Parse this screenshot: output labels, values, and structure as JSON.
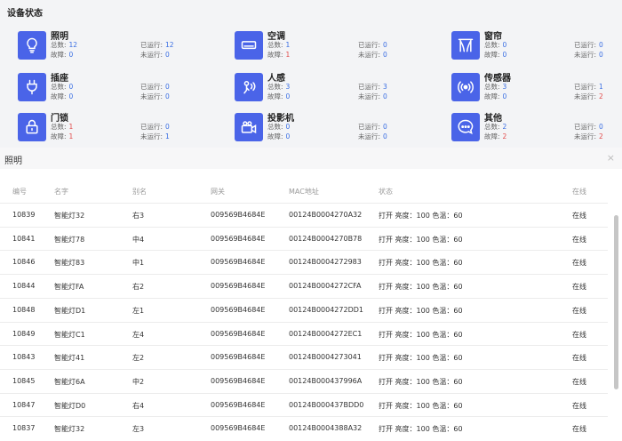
{
  "page_title": "设备状态",
  "labels": {
    "total": "总数:",
    "fault": "故障:",
    "running": "已运行:",
    "stopped": "未运行:"
  },
  "colors": {
    "accent": "#4a64e8",
    "count_blue": "#3b6fe3",
    "count_red": "#e24b4b"
  },
  "cards": [
    {
      "name": "照明",
      "icon": "lightbulb-icon",
      "total": "12",
      "fault": "0",
      "running": "12",
      "stopped": "0"
    },
    {
      "name": "空调",
      "icon": "air-conditioner-icon",
      "total": "1",
      "fault": "1",
      "running": "0",
      "stopped": "0"
    },
    {
      "name": "窗帘",
      "icon": "curtain-icon",
      "total": "0",
      "fault": "0",
      "running": "0",
      "stopped": "0"
    },
    {
      "name": "插座",
      "icon": "plug-icon",
      "total": "0",
      "fault": "0",
      "running": "0",
      "stopped": "0"
    },
    {
      "name": "人感",
      "icon": "presence-sensor-icon",
      "total": "3",
      "fault": "0",
      "running": "3",
      "stopped": "0"
    },
    {
      "name": "传感器",
      "icon": "sensor-icon",
      "total": "3",
      "fault": "0",
      "running": "1",
      "stopped": "2"
    },
    {
      "name": "门锁",
      "icon": "lock-icon",
      "total": "1",
      "fault": "1",
      "running": "0",
      "stopped": "1"
    },
    {
      "name": "投影机",
      "icon": "projector-icon",
      "total": "0",
      "fault": "0",
      "running": "0",
      "stopped": "0"
    },
    {
      "name": "其他",
      "icon": "other-chat-icon",
      "total": "2",
      "fault": "2",
      "running": "0",
      "stopped": "2"
    }
  ],
  "panel": {
    "title": "照明",
    "close": "×"
  },
  "table": {
    "columns": [
      "编号",
      "名字",
      "别名",
      "网关",
      "MAC地址",
      "状态",
      "在线"
    ],
    "rows": [
      [
        "10839",
        "智能灯32",
        "右3",
        "009569B4684E",
        "00124B0004270A32",
        "打开 亮度：100 色温：60",
        "在线"
      ],
      [
        "10841",
        "智能灯78",
        "中4",
        "009569B4684E",
        "00124B0004270B78",
        "打开 亮度：100 色温：60",
        "在线"
      ],
      [
        "10846",
        "智能灯83",
        "中1",
        "009569B4684E",
        "00124B0004272983",
        "打开 亮度：100 色温：60",
        "在线"
      ],
      [
        "10844",
        "智能灯FA",
        "右2",
        "009569B4684E",
        "00124B0004272CFA",
        "打开 亮度：100 色温：60",
        "在线"
      ],
      [
        "10848",
        "智能灯D1",
        "左1",
        "009569B4684E",
        "00124B0004272DD1",
        "打开 亮度：100 色温：60",
        "在线"
      ],
      [
        "10849",
        "智能灯C1",
        "左4",
        "009569B4684E",
        "00124B0004272EC1",
        "打开 亮度：100 色温：60",
        "在线"
      ],
      [
        "10843",
        "智能灯41",
        "左2",
        "009569B4684E",
        "00124B0004273041",
        "打开 亮度：100 色温：60",
        "在线"
      ],
      [
        "10845",
        "智能灯6A",
        "中2",
        "009569B4684E",
        "00124B000437996A",
        "打开 亮度：100 色温：60",
        "在线"
      ],
      [
        "10847",
        "智能灯D0",
        "右4",
        "009569B4684E",
        "00124B000437BDD0",
        "打开 亮度：100 色温：60",
        "在线"
      ],
      [
        "10837",
        "智能灯32",
        "左3",
        "009569B4684E",
        "00124B0004388A32",
        "打开 亮度：100 色温：60",
        "在线"
      ]
    ]
  }
}
